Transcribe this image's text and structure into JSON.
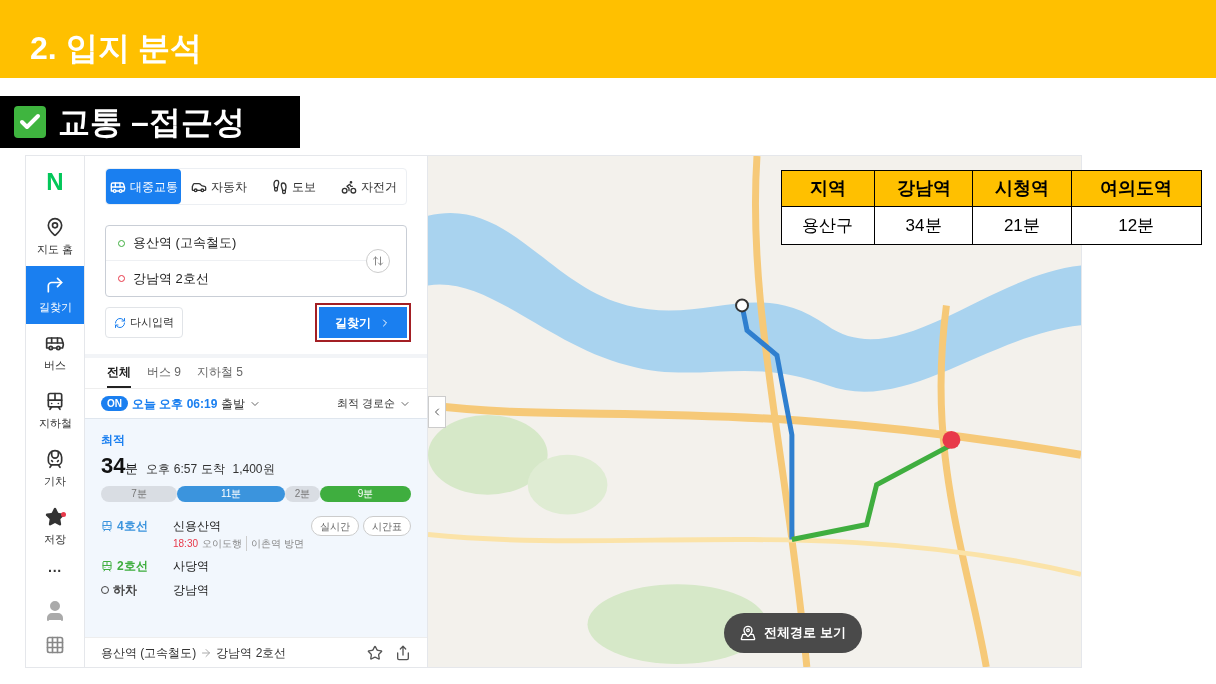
{
  "slide_title": "2. 입지 분석",
  "section_label": {
    "text": "교통 –접근성",
    "checked": true
  },
  "rail": {
    "logo": "N",
    "items": [
      {
        "label": "지도 홈",
        "kind": "pin",
        "selected": false,
        "dot": false
      },
      {
        "label": "길찾기",
        "kind": "turn",
        "selected": true,
        "dot": false
      },
      {
        "label": "버스",
        "kind": "bus",
        "selected": false,
        "dot": false
      },
      {
        "label": "지하철",
        "kind": "subway",
        "selected": false,
        "dot": false
      },
      {
        "label": "기차",
        "kind": "train",
        "selected": false,
        "dot": false
      },
      {
        "label": "저장",
        "kind": "star",
        "selected": false,
        "dot": true
      }
    ],
    "more": "···"
  },
  "modes": [
    {
      "label": "대중교통",
      "kind": "bus",
      "selected": true
    },
    {
      "label": "자동차",
      "kind": "car",
      "selected": false
    },
    {
      "label": "도보",
      "kind": "walk",
      "selected": false
    },
    {
      "label": "자전거",
      "kind": "bike",
      "selected": false
    }
  ],
  "origin": "용산역 (고속철도)",
  "destination": "강남역 2호선",
  "reset_button": "다시입력",
  "search_button": "길찾기",
  "result_tabs": [
    {
      "label": "전체",
      "selected": true
    },
    {
      "label": "버스 9",
      "selected": false
    },
    {
      "label": "지하철 5",
      "selected": false
    }
  ],
  "departure": {
    "toggle": "ON",
    "on": true,
    "time": "오늘 오후 06:19",
    "suffix": "출발"
  },
  "sort": "최적 경로순",
  "route": {
    "badge": "최적",
    "duration": "34",
    "unit": "분",
    "arrival": "오후 6:57 도착",
    "fare": "1,400원",
    "segments": [
      {
        "kind": "walk",
        "label": "7분",
        "color": "#d9dde3"
      },
      {
        "kind": "subway",
        "label": "11분",
        "color": "#3b94dd"
      },
      {
        "kind": "transfer",
        "label": "2분",
        "color": "#d9dde3"
      },
      {
        "kind": "subway",
        "label": "9분",
        "color": "#3fae3f"
      }
    ],
    "steps": [
      {
        "kind": "subway",
        "line": "4호선",
        "color": "#3b94dd",
        "station": "신용산역",
        "buttons": [
          "실시간",
          "시간표"
        ],
        "time": "18:30",
        "direction": "오이도행",
        "platform": "이촌역 방면"
      },
      {
        "kind": "subway",
        "line": "2호선",
        "color": "#3fae3f",
        "station": "사당역"
      },
      {
        "kind": "exit",
        "line": "하차",
        "color": "#444444",
        "station": "강남역"
      }
    ]
  },
  "footer": {
    "from": "용산역 (고속철도)",
    "to": "강남역 2호선"
  },
  "map_button": "전체경로 보기",
  "table": {
    "columns": [
      "지역",
      "강남역",
      "시청역",
      "여의도역"
    ],
    "rows": [
      [
        "용산구",
        "34분",
        "21분",
        "12분"
      ]
    ]
  }
}
